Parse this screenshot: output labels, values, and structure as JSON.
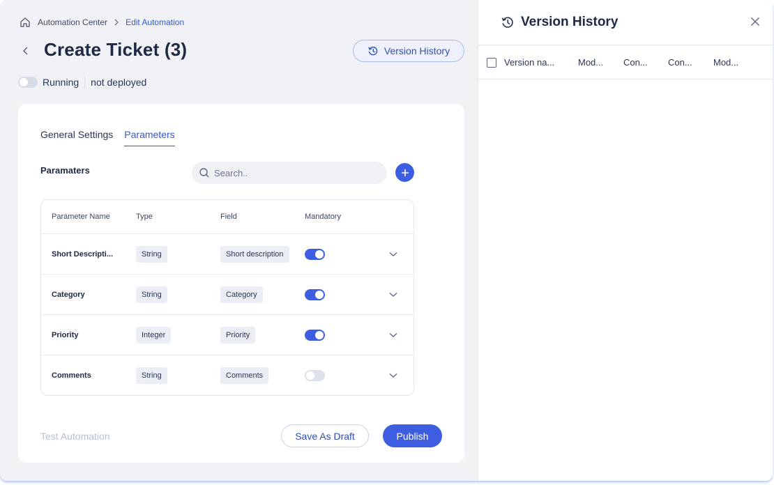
{
  "breadcrumb": {
    "home_icon": "home-icon",
    "parent": "Automation Center",
    "current": "Edit Automation"
  },
  "header": {
    "title": "Create Ticket (3)",
    "version_history_button": "Version History"
  },
  "status": {
    "running_label": "Running",
    "running_on": false,
    "deploy_label": "not deployed"
  },
  "tabs": [
    {
      "label": "General Settings",
      "active": false
    },
    {
      "label": "Parameters",
      "active": true
    }
  ],
  "params": {
    "title": "Paramaters",
    "search_placeholder": "Search..",
    "columns": {
      "name": "Parameter Name",
      "type": "Type",
      "field": "Field",
      "mandatory": "Mandatory"
    },
    "rows": [
      {
        "name": "Short Descripti...",
        "type": "String",
        "field": "Short description",
        "mandatory": true
      },
      {
        "name": "Category",
        "type": "String",
        "field": "Category",
        "mandatory": true
      },
      {
        "name": "Priority",
        "type": "Integer",
        "field": "Priority",
        "mandatory": true
      },
      {
        "name": "Comments",
        "type": "String",
        "field": "Comments",
        "mandatory": false
      }
    ]
  },
  "footer": {
    "test_automation": "Test Automation",
    "save_draft": "Save As Draft",
    "publish": "Publish"
  },
  "panel": {
    "title": "Version History",
    "columns": [
      "Version na...",
      "Mod...",
      "Con...",
      "Con...",
      "Mod..."
    ]
  },
  "colors": {
    "accent": "#3d5ee0",
    "link": "#3057d5",
    "background": "#f1f2f6"
  }
}
